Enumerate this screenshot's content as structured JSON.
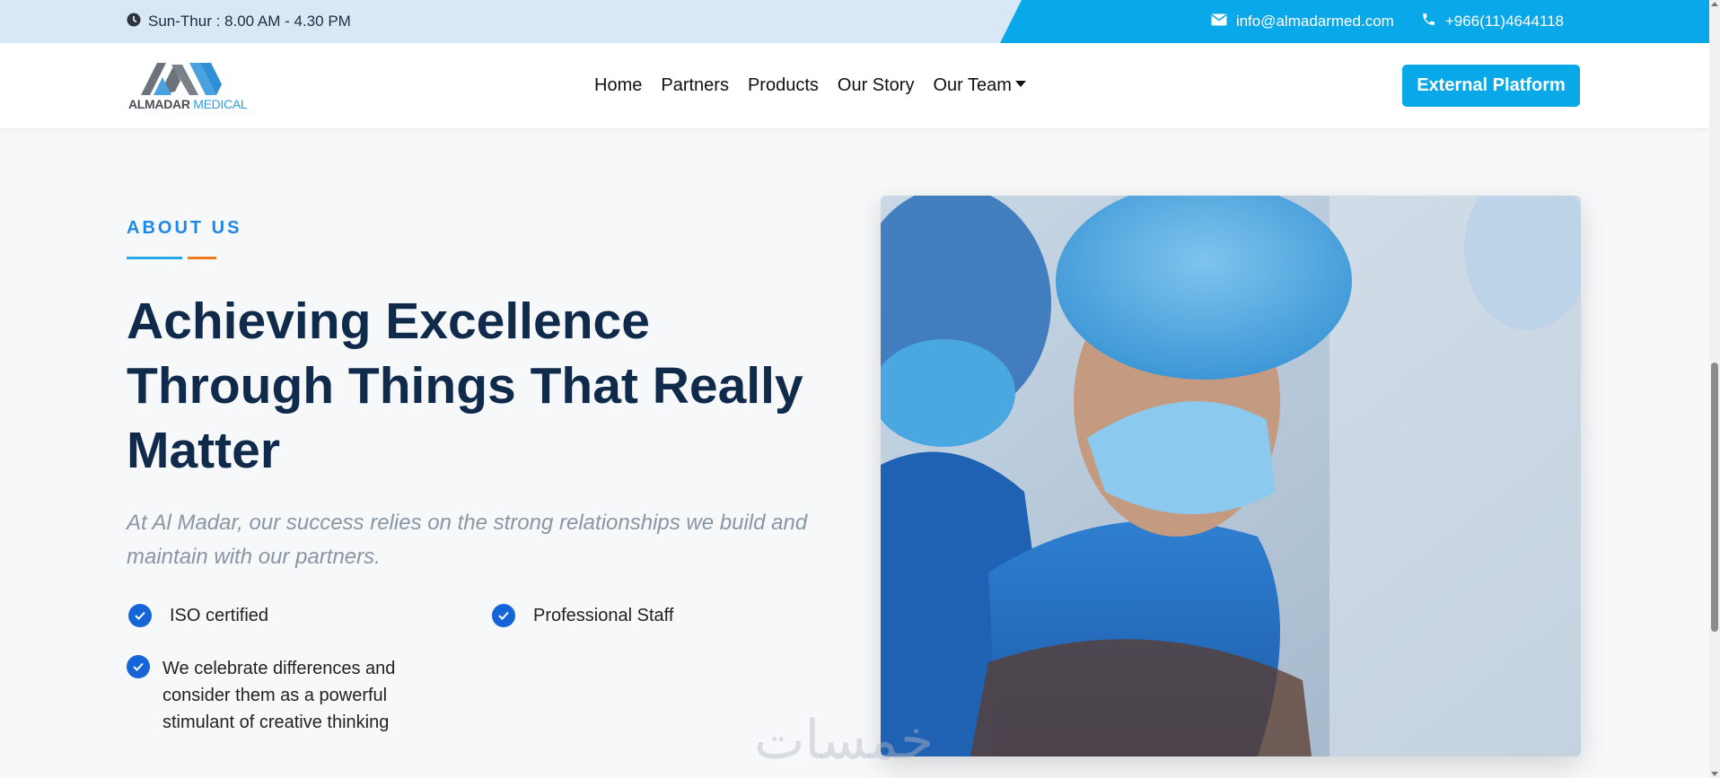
{
  "topbar": {
    "hours": "Sun-Thur : 8.00 AM - 4.30 PM",
    "email": "info@almadarmed.com",
    "phone": "+966(11)4644118"
  },
  "logo": {
    "brand_part1": "ALMADAR",
    "brand_part2": "MEDICAL"
  },
  "nav": {
    "items": [
      "Home",
      "Partners",
      "Products",
      "Our Story",
      "Our Team"
    ],
    "external_button": "External Platform"
  },
  "about": {
    "eyebrow": "ABOUT US",
    "heading": "Achieving Excellence Through Things That Really Matter",
    "lead": "At Al Madar, our success relies on the strong relationships we build and maintain with our partners.",
    "features": [
      "ISO certified",
      "Professional Staff",
      "We celebrate differences and consider them as a powerful stimulant of creative thinking"
    ]
  },
  "watermark": "خمسات",
  "colors": {
    "accent": "#09a8e8",
    "heading": "#102a4c",
    "check": "#1565d8",
    "orange": "#f07c1e"
  }
}
